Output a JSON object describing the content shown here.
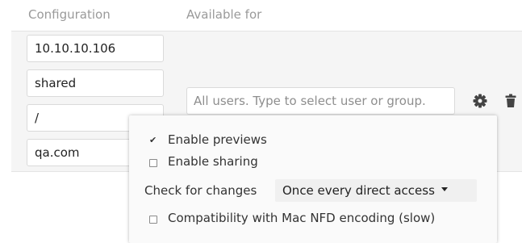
{
  "header": {
    "configuration_label": "Configuration",
    "available_for_label": "Available for"
  },
  "mount": {
    "fields": [
      {
        "value": "10.10.10.106"
      },
      {
        "value": "shared"
      },
      {
        "value": "/"
      },
      {
        "value": "qa.com"
      }
    ],
    "available_for_placeholder": "All users. Type to select user or group.",
    "settings_icon": "gear-icon",
    "delete_icon": "trash-icon"
  },
  "popup": {
    "enable_previews": {
      "label": "Enable previews",
      "checked": true
    },
    "enable_sharing": {
      "label": "Enable sharing",
      "checked": false
    },
    "check_for_changes_label": "Check for changes",
    "check_for_changes_value": "Once every direct access",
    "mac_nfd": {
      "label": "Compatibility with Mac NFD encoding (slow)",
      "checked": false
    }
  }
}
